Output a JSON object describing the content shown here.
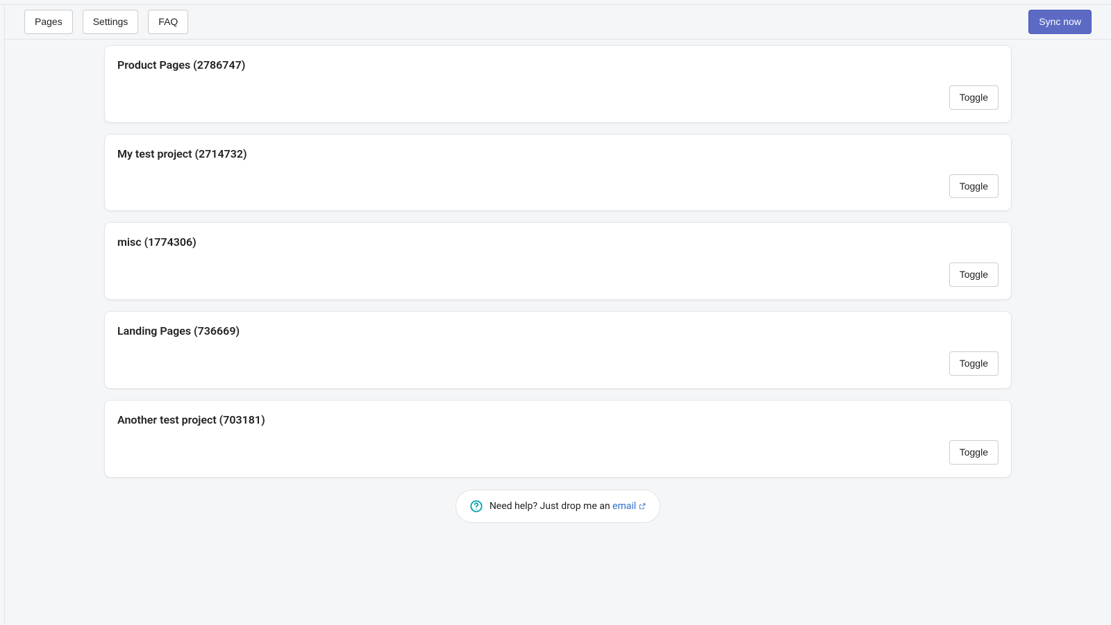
{
  "toolbar": {
    "pages_label": "Pages",
    "settings_label": "Settings",
    "faq_label": "FAQ",
    "sync_label": "Sync now"
  },
  "cards": [
    {
      "title": "Product Pages (2786747)",
      "toggle_label": "Toggle"
    },
    {
      "title": "My test project (2714732)",
      "toggle_label": "Toggle"
    },
    {
      "title": "misc (1774306)",
      "toggle_label": "Toggle"
    },
    {
      "title": "Landing Pages (736669)",
      "toggle_label": "Toggle"
    },
    {
      "title": "Another test project (703181)",
      "toggle_label": "Toggle"
    }
  ],
  "help": {
    "prefix": "Need help? Just drop me an ",
    "link_text": "email"
  }
}
